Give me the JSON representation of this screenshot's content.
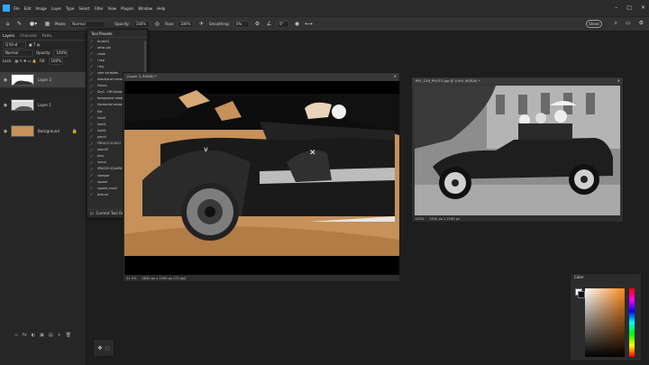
{
  "menubar": {
    "items": [
      "File",
      "Edit",
      "Image",
      "Layer",
      "Type",
      "Select",
      "Filter",
      "View",
      "Plugins",
      "Window",
      "Help"
    ],
    "window_controls": [
      "–",
      "□",
      "✕"
    ]
  },
  "optionsbar": {
    "mode_label": "Mode:",
    "mode_value": "Normal",
    "opacity_label": "Opacity:",
    "opacity_value": "100%",
    "flow_label": "Flow:",
    "flow_value": "100%",
    "smoothing_label": "Smoothing:",
    "smoothing_value": "0%",
    "angle_value": "0°",
    "share_label": "Share"
  },
  "layers_panel": {
    "tabs": [
      "Layers",
      "Channels",
      "Paths"
    ],
    "kind_label": "Q Kind",
    "blend_value": "Normal",
    "opacity_label": "Opacity:",
    "opacity_value": "100%",
    "lock_label": "Lock:",
    "fill_label": "Fill:",
    "fill_value": "100%",
    "layers": [
      {
        "name": "Layer 3"
      },
      {
        "name": "Layer 1"
      },
      {
        "name": "Background"
      }
    ],
    "footer_icons": [
      "∞",
      "fx",
      "◐",
      "▣",
      "▤",
      "+",
      "🗑"
    ]
  },
  "tool_presets": {
    "title": "Tool Presets",
    "items": [
      "brush01",
      "artist pla",
      "chalk",
      "l sep",
      "l dry",
      "rake variables",
      "directional rectangle",
      "Fresco",
      "Dry1 - HM Scratchy Brush",
      "foreground rotate",
      "Horizontal rectangle",
      "flat",
      "hard1",
      "hard1",
      "hard2",
      "pencil",
      "FRESCO SCUCU",
      "pencil3",
      "pino",
      "round",
      "SPACED SQUARED",
      "stamper",
      "square",
      "square_small",
      "texture"
    ],
    "footer_label": "Current Tool Only"
  },
  "doc1": {
    "title": "(Layer 3, RGB/8) *",
    "zoom": "41.5%",
    "size": "3840 px x 2160 px (72 ppi)"
  },
  "doc2": {
    "title": "REF_CAR_PHOTO.jpg @ 100% (RGB/8) *",
    "zoom": "100%",
    "size": "3540 px x 2160 px"
  },
  "color_panel": {
    "title": "Color"
  },
  "colors": {
    "accent": "#31a8ff",
    "sepia": "#c6915a",
    "panel": "#2b2b2b"
  }
}
